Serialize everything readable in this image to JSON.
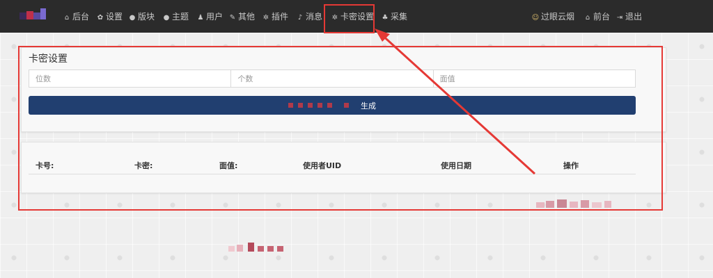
{
  "navbar": {
    "items": [
      {
        "label": "后台",
        "icon": "home-icon"
      },
      {
        "label": "设置",
        "icon": "gear-icon"
      },
      {
        "label": "版块",
        "icon": "comment-icon"
      },
      {
        "label": "主题",
        "icon": "comment-icon"
      },
      {
        "label": "用户",
        "icon": "user-icon"
      },
      {
        "label": "其他",
        "icon": "wrench-icon"
      },
      {
        "label": "插件",
        "icon": "gears-icon"
      },
      {
        "label": "消息",
        "icon": "bell-icon"
      },
      {
        "label": "卡密设置",
        "icon": "gears-icon"
      },
      {
        "label": "采集",
        "icon": "tree-icon"
      }
    ],
    "right": [
      {
        "label": "过眼云烟",
        "icon": "avatar-icon"
      },
      {
        "label": "前台",
        "icon": "home-icon"
      },
      {
        "label": "退出",
        "icon": "logout-icon"
      }
    ]
  },
  "card_settings": {
    "title": "卡密设置",
    "placeholders": {
      "digits": "位数",
      "count": "个数",
      "face_value": "面值"
    },
    "generate_label": "生成"
  },
  "table": {
    "headers": [
      "卡号:",
      "卡密:",
      "面值:",
      "使用者UID",
      "使用日期",
      "操作"
    ]
  },
  "colors": {
    "navbar": "#2b2b2b",
    "button": "#213f70",
    "annotation": "#e53935"
  }
}
